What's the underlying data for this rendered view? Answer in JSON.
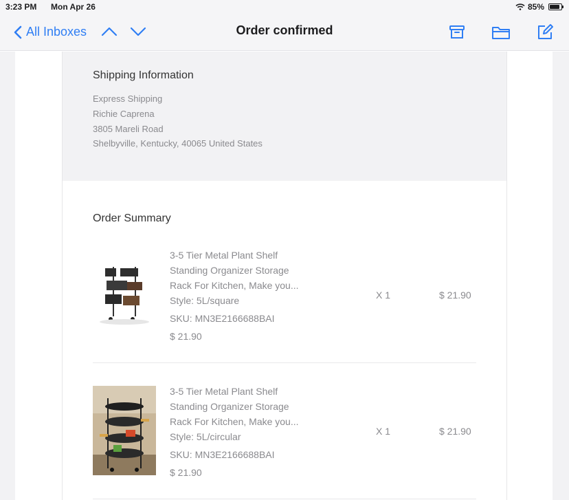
{
  "status_bar": {
    "time": "3:23 PM",
    "date": "Mon Apr 26",
    "battery": "85%",
    "battery_level": 0.85,
    "wifi_icon": "wifi-icon"
  },
  "nav": {
    "back_label": "All Inboxes",
    "title": "Order confirmed",
    "icons": [
      "chevron-left-icon",
      "chevron-up-icon",
      "chevron-down-icon",
      "archive-icon",
      "folder-icon",
      "compose-icon"
    ],
    "accent": "#2f7ef4"
  },
  "shipping": {
    "heading": "Shipping Information",
    "lines": [
      "Express Shipping",
      "Richie Caprena",
      "3805 Mareli Road",
      "Shelbyville, Kentucky, 40065 United States"
    ]
  },
  "summary": {
    "heading": "Order Summary",
    "items": [
      {
        "name_lines": [
          "3-5 Tier Metal Plant Shelf",
          "Standing Organizer Storage",
          "Rack For Kitchen,  Make you..."
        ],
        "style": "Style: 5L/square",
        "sku": "SKU: MN3E2166688BAI",
        "unit_price": "$ 21.90",
        "qty": "X 1",
        "price": "$ 21.90"
      },
      {
        "name_lines": [
          "3-5 Tier Metal Plant Shelf",
          "Standing Organizer Storage",
          "Rack For Kitchen,  Make you..."
        ],
        "style": "Style: 5L/circular",
        "sku": "SKU: MN3E2166688BAI",
        "unit_price": "$ 21.90",
        "qty": "X 1",
        "price": "$ 21.90"
      }
    ]
  }
}
